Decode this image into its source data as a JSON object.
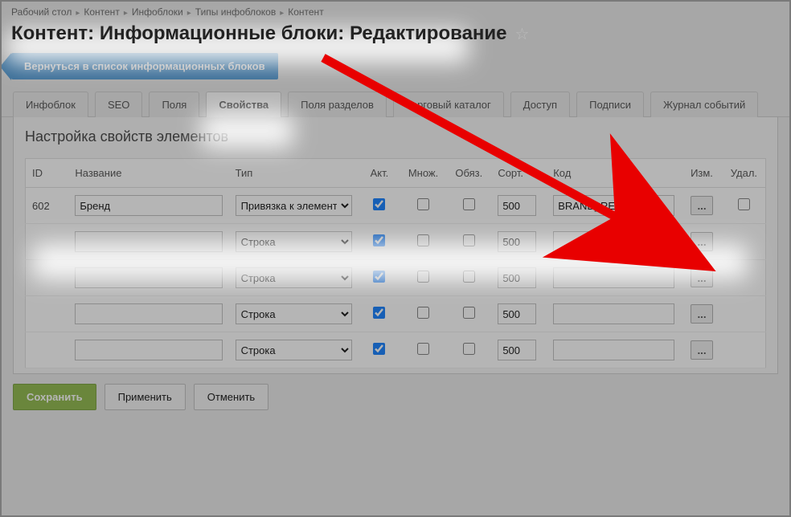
{
  "breadcrumbs": [
    "Рабочий стол",
    "Контент",
    "Инфоблоки",
    "Типы инфоблоков",
    "Контент"
  ],
  "page_title": "Контент: Информационные блоки: Редактирование",
  "back_button": "Вернуться в список информационных блоков",
  "tabs": [
    {
      "label": "Инфоблок"
    },
    {
      "label": "SEO"
    },
    {
      "label": "Поля"
    },
    {
      "label": "Свойства",
      "active": true
    },
    {
      "label": "Поля разделов"
    },
    {
      "label": "Торговый каталог"
    },
    {
      "label": "Доступ"
    },
    {
      "label": "Подписи"
    },
    {
      "label": "Журнал событий"
    }
  ],
  "section_title": "Настройка свойств элементов",
  "columns": {
    "id": "ID",
    "name": "Название",
    "type": "Тип",
    "active": "Акт.",
    "multiple": "Множ.",
    "required": "Обяз.",
    "sort": "Сорт.",
    "code": "Код",
    "edit": "Изм.",
    "delete": "Удал."
  },
  "type_options": {
    "binding": "Привязка к элементам",
    "string": "Строка"
  },
  "rows": [
    {
      "id": "602",
      "name": "Бренд",
      "type": "binding",
      "active": true,
      "multiple": false,
      "required": false,
      "sort": "500",
      "code": "BRAND_REF",
      "hl": true,
      "deletable": true
    },
    {
      "id": "",
      "name": "",
      "type": "string",
      "active": true,
      "multiple": false,
      "required": false,
      "sort": "500",
      "code": ""
    },
    {
      "id": "",
      "name": "",
      "type": "string",
      "active": true,
      "multiple": false,
      "required": false,
      "sort": "500",
      "code": ""
    },
    {
      "id": "",
      "name": "",
      "type": "string",
      "active": true,
      "multiple": false,
      "required": false,
      "sort": "500",
      "code": ""
    },
    {
      "id": "",
      "name": "",
      "type": "string",
      "active": true,
      "multiple": false,
      "required": false,
      "sort": "500",
      "code": ""
    }
  ],
  "more_btn": "...",
  "footer": {
    "save": "Сохранить",
    "apply": "Применить",
    "cancel": "Отменить"
  }
}
